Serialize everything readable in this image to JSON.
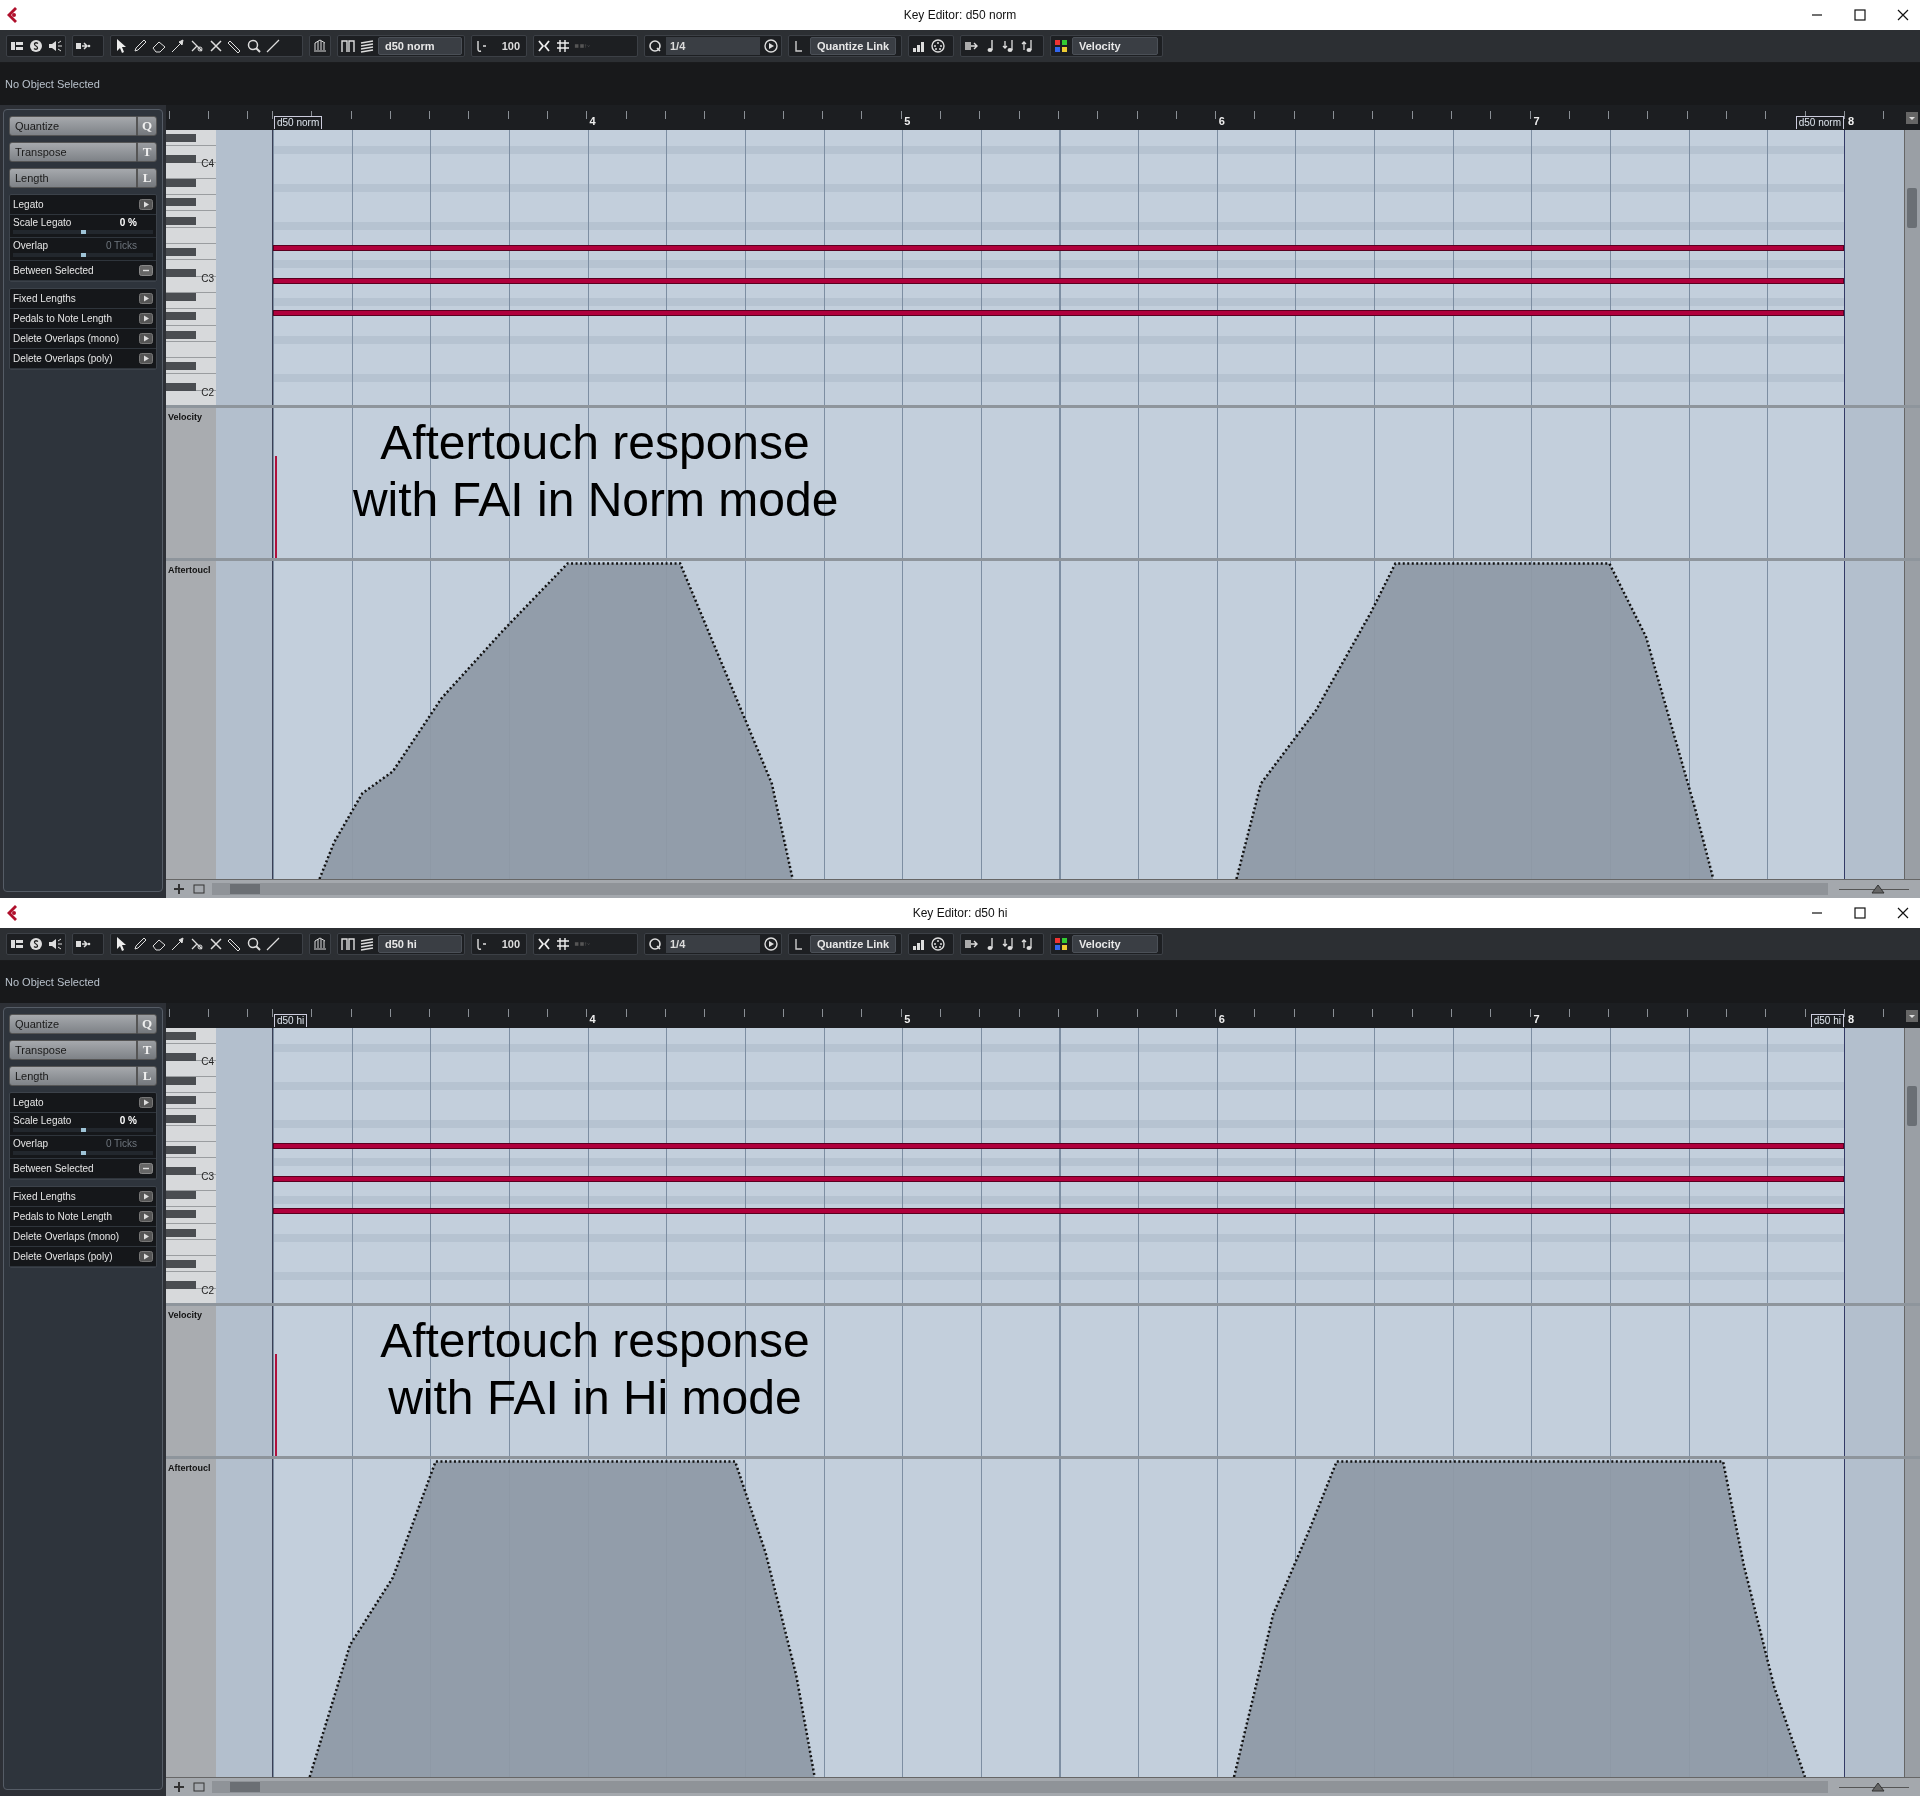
{
  "windows": [
    {
      "title": "Key Editor: d50 norm",
      "toolbar": {
        "part": "d50 norm",
        "velocity_value": "100",
        "quantize": "1/4",
        "quantize_link": "Quantize Link",
        "controller": "Velocity"
      },
      "info": "No Object Selected",
      "inspector": {
        "sections": [
          {
            "label": "Quantize",
            "key": "Q"
          },
          {
            "label": "Transpose",
            "key": "T"
          },
          {
            "label": "Length",
            "key": "L"
          }
        ],
        "length_rows": [
          {
            "kind": "action",
            "label": "Legato"
          },
          {
            "kind": "slider",
            "label": "Scale Legato",
            "value": "0 %",
            "disabled": false,
            "level": 0.5
          },
          {
            "kind": "slider",
            "label": "Overlap",
            "value": "0 Ticks",
            "disabled": true,
            "level": 0.5
          },
          {
            "kind": "toggle",
            "label": "Between Selected"
          }
        ],
        "function_rows": [
          "Fixed Lengths",
          "Pedals to Note Length",
          "Delete Overlaps (mono)",
          "Delete Overlaps (poly)"
        ]
      },
      "ruler": {
        "start_label": "d50 norm",
        "end_label": "d50 norm",
        "bars": [
          "4",
          "5",
          "6",
          "7",
          "8"
        ]
      },
      "keys": [
        "C4",
        "C3",
        "C2"
      ],
      "lanes": [
        {
          "kind": "velocity",
          "label": "Velocity"
        },
        {
          "kind": "aftertouch",
          "label": "Aftertoucl"
        }
      ],
      "annotation": [
        "Aftertouch response",
        "with FAI in Norm mode"
      ],
      "zoom": {
        "level": 0.55
      }
    },
    {
      "title": "Key Editor: d50 hi",
      "toolbar": {
        "part": "d50 hi",
        "velocity_value": "100",
        "quantize": "1/4",
        "quantize_link": "Quantize Link",
        "controller": "Velocity"
      },
      "info": "No Object Selected",
      "inspector": {
        "sections": [
          {
            "label": "Quantize",
            "key": "Q"
          },
          {
            "label": "Transpose",
            "key": "T"
          },
          {
            "label": "Length",
            "key": "L"
          }
        ],
        "length_rows": [
          {
            "kind": "action",
            "label": "Legato"
          },
          {
            "kind": "slider",
            "label": "Scale Legato",
            "value": "0 %",
            "disabled": false,
            "level": 0.5
          },
          {
            "kind": "slider",
            "label": "Overlap",
            "value": "0 Ticks",
            "disabled": true,
            "level": 0.5
          },
          {
            "kind": "toggle",
            "label": "Between Selected"
          }
        ],
        "function_rows": [
          "Fixed Lengths",
          "Pedals to Note Length",
          "Delete Overlaps (mono)",
          "Delete Overlaps (poly)"
        ]
      },
      "ruler": {
        "start_label": "d50 hi",
        "end_label": "d50 hi",
        "bars": [
          "4",
          "5",
          "6",
          "7",
          "8"
        ]
      },
      "keys": [
        "C4",
        "C3",
        "C2"
      ],
      "lanes": [
        {
          "kind": "velocity",
          "label": "Velocity"
        },
        {
          "kind": "aftertouch",
          "label": "Aftertoucl"
        }
      ],
      "annotation": [
        "Aftertouch response",
        "with FAI in Hi mode"
      ],
      "zoom": {
        "level": 0.55
      }
    }
  ]
}
